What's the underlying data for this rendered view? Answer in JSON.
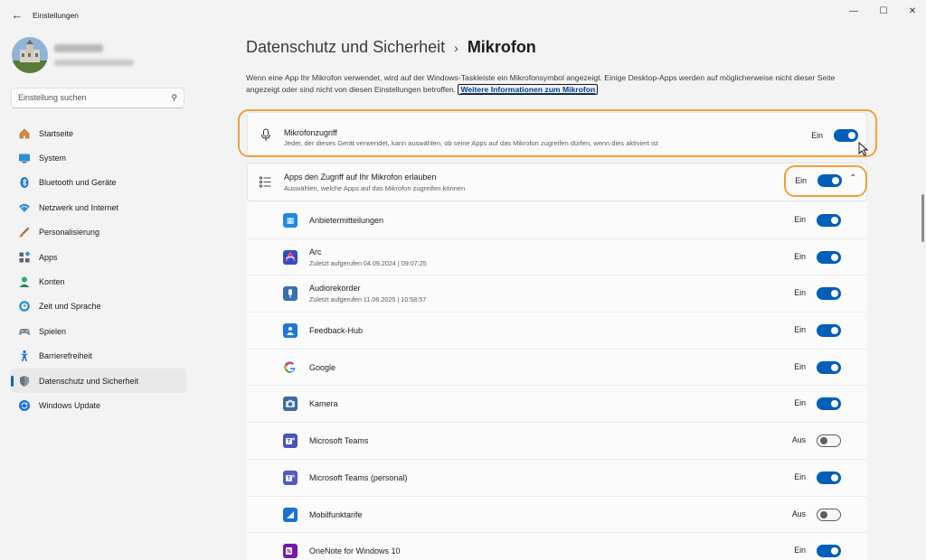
{
  "window": {
    "title": "Einstellungen",
    "back_icon": "arrow-left-icon",
    "controls": [
      "minimize-icon",
      "maximize-icon",
      "close-icon"
    ]
  },
  "search": {
    "placeholder": "Einstellung suchen"
  },
  "sidebar": {
    "items": [
      {
        "label": "Startseite",
        "icon": "home-icon"
      },
      {
        "label": "System",
        "icon": "monitor-icon"
      },
      {
        "label": "Bluetooth und Geräte",
        "icon": "bluetooth-icon"
      },
      {
        "label": "Netzwerk und Internet",
        "icon": "wifi-icon"
      },
      {
        "label": "Personalisierung",
        "icon": "brush-icon"
      },
      {
        "label": "Apps",
        "icon": "apps-icon"
      },
      {
        "label": "Konten",
        "icon": "person-icon"
      },
      {
        "label": "Zeit und Sprache",
        "icon": "globe-clock-icon"
      },
      {
        "label": "Spielen",
        "icon": "gamepad-icon"
      },
      {
        "label": "Barrierefreiheit",
        "icon": "accessibility-icon"
      },
      {
        "label": "Datenschutz und Sicherheit",
        "icon": "shield-icon",
        "active": true
      },
      {
        "label": "Windows Update",
        "icon": "update-icon"
      }
    ]
  },
  "header": {
    "parent": "Datenschutz und Sicherheit",
    "separator": "›",
    "current": "Mikrofon"
  },
  "description": {
    "text": "Wenn eine App Ihr Mikrofon verwendet, wird auf der Windows-Taskleiste ein Mikrofonsymbol angezeigt. Einige Desktop-Apps werden auf möglicherweise nicht dieser Seite angezeigt oder sind nicht von diesen Einstellungen betroffen.",
    "link": "Weitere Informationen zum Mikrofon"
  },
  "mic_access": {
    "title": "Mikrofonzugriff",
    "subtitle": "Jeder, der dieses Gerät verwendet, kann auswählen, ob seine Apps auf das Mikrofon zugreifen dürfen, wenn dies aktiviert ist",
    "state": "Ein",
    "on": true,
    "icon": "microphone-icon"
  },
  "apps_access": {
    "title": "Apps den Zugriff auf Ihr Mikrofon erlauben",
    "subtitle": "Auswählen, welche Apps auf das Mikrofon zugreifen können",
    "state": "Ein",
    "on": true,
    "icon": "list-icon",
    "expand_icon": "chevron-up-icon"
  },
  "apps": [
    {
      "name": "Anbietermitteilungen",
      "sub": "",
      "state": "Ein",
      "on": true,
      "icon": "carrier-messaging-icon",
      "color": "#1e88e5"
    },
    {
      "name": "Arc",
      "sub": "Zuletzt aufgerufen 04.09.2024  |  09:07:25",
      "state": "Ein",
      "on": true,
      "icon": "arc-browser-icon",
      "color": "#2b4fc7"
    },
    {
      "name": "Audiorekorder",
      "sub": "Zuletzt aufgerufen 11.06.2025  |  10:58:57",
      "state": "Ein",
      "on": true,
      "icon": "sound-recorder-icon",
      "color": "#3a6fb0"
    },
    {
      "name": "Feedback-Hub",
      "sub": "",
      "state": "Ein",
      "on": true,
      "icon": "feedback-hub-icon",
      "color": "#1f7ad6"
    },
    {
      "name": "Google",
      "sub": "",
      "state": "Ein",
      "on": true,
      "icon": "google-icon",
      "color": "#ffffff"
    },
    {
      "name": "Kamera",
      "sub": "",
      "state": "Ein",
      "on": true,
      "icon": "camera-icon",
      "color": "#3d6a9e"
    },
    {
      "name": "Microsoft Teams",
      "sub": "",
      "state": "Aus",
      "on": false,
      "icon": "teams-icon",
      "color": "#4b53bc"
    },
    {
      "name": "Microsoft Teams (personal)",
      "sub": "",
      "state": "Ein",
      "on": true,
      "icon": "teams-personal-icon",
      "color": "#5059c9"
    },
    {
      "name": "Mobilfunktarife",
      "sub": "",
      "state": "Aus",
      "on": false,
      "icon": "mobile-plans-icon",
      "color": "#1a73c9"
    },
    {
      "name": "OneNote for Windows 10",
      "sub": "",
      "state": "Ein",
      "on": true,
      "icon": "onenote-icon",
      "color": "#7719aa"
    }
  ],
  "colors": {
    "accent": "#005fb8",
    "highlight": "#f0a03a"
  }
}
